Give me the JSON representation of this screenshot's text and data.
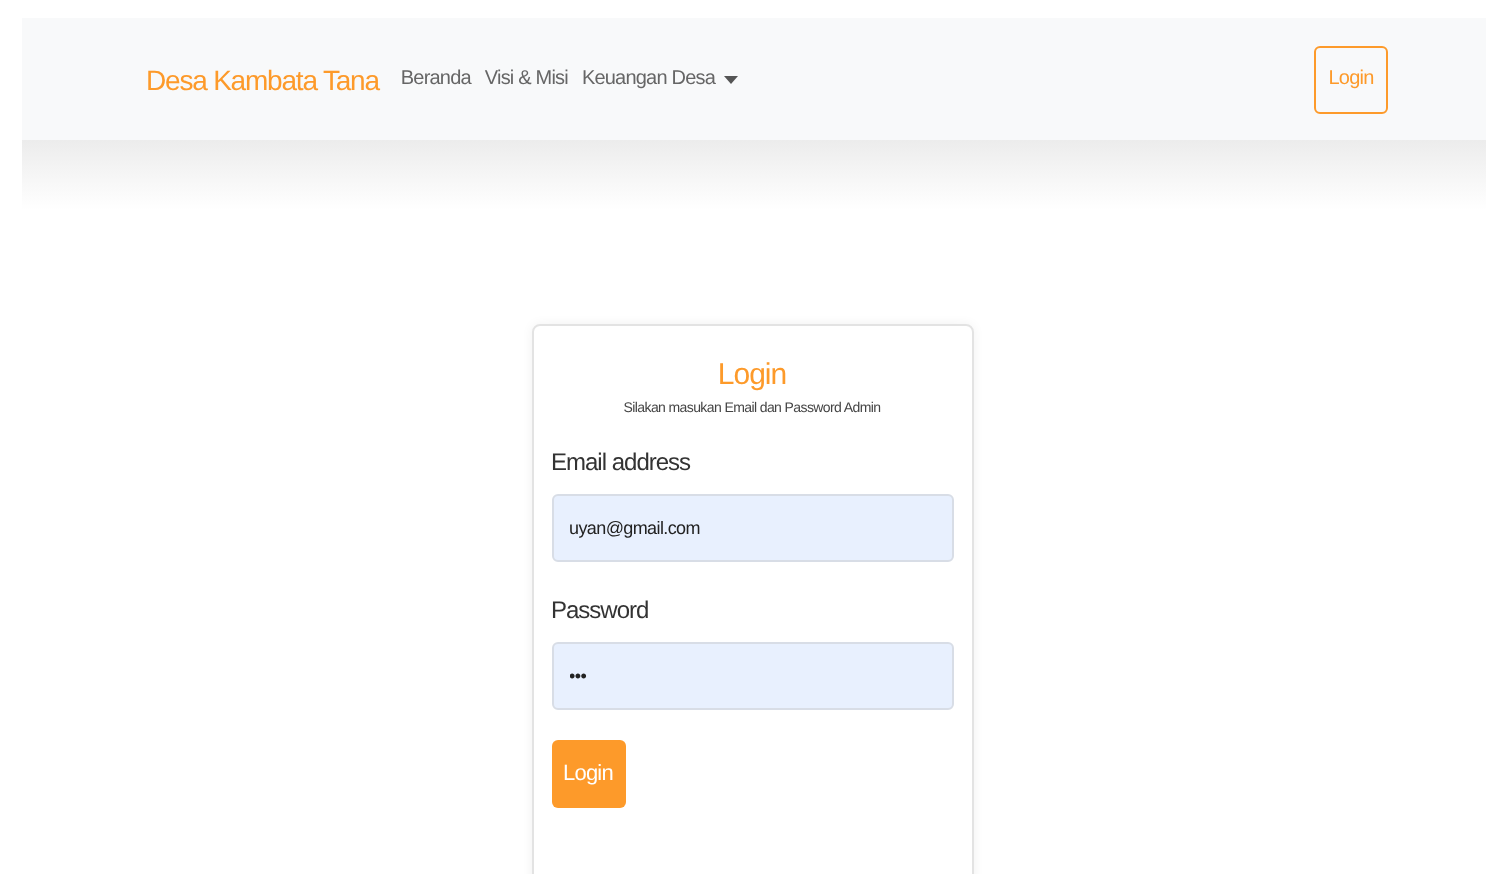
{
  "navbar": {
    "brand": "Desa Kambata Tana",
    "links": [
      {
        "label": "Beranda",
        "dropdown": false
      },
      {
        "label": "Visi & Misi",
        "dropdown": false
      },
      {
        "label": "Keuangan Desa",
        "dropdown": true
      }
    ],
    "login_button": "Login"
  },
  "login_card": {
    "title": "Login",
    "subtitle": "Silakan masukan Email dan Password Admin",
    "fields": [
      {
        "label": "Email address",
        "value": "uyan@gmail.com"
      },
      {
        "label": "Password",
        "value": "•••"
      }
    ],
    "button": "Login"
  }
}
